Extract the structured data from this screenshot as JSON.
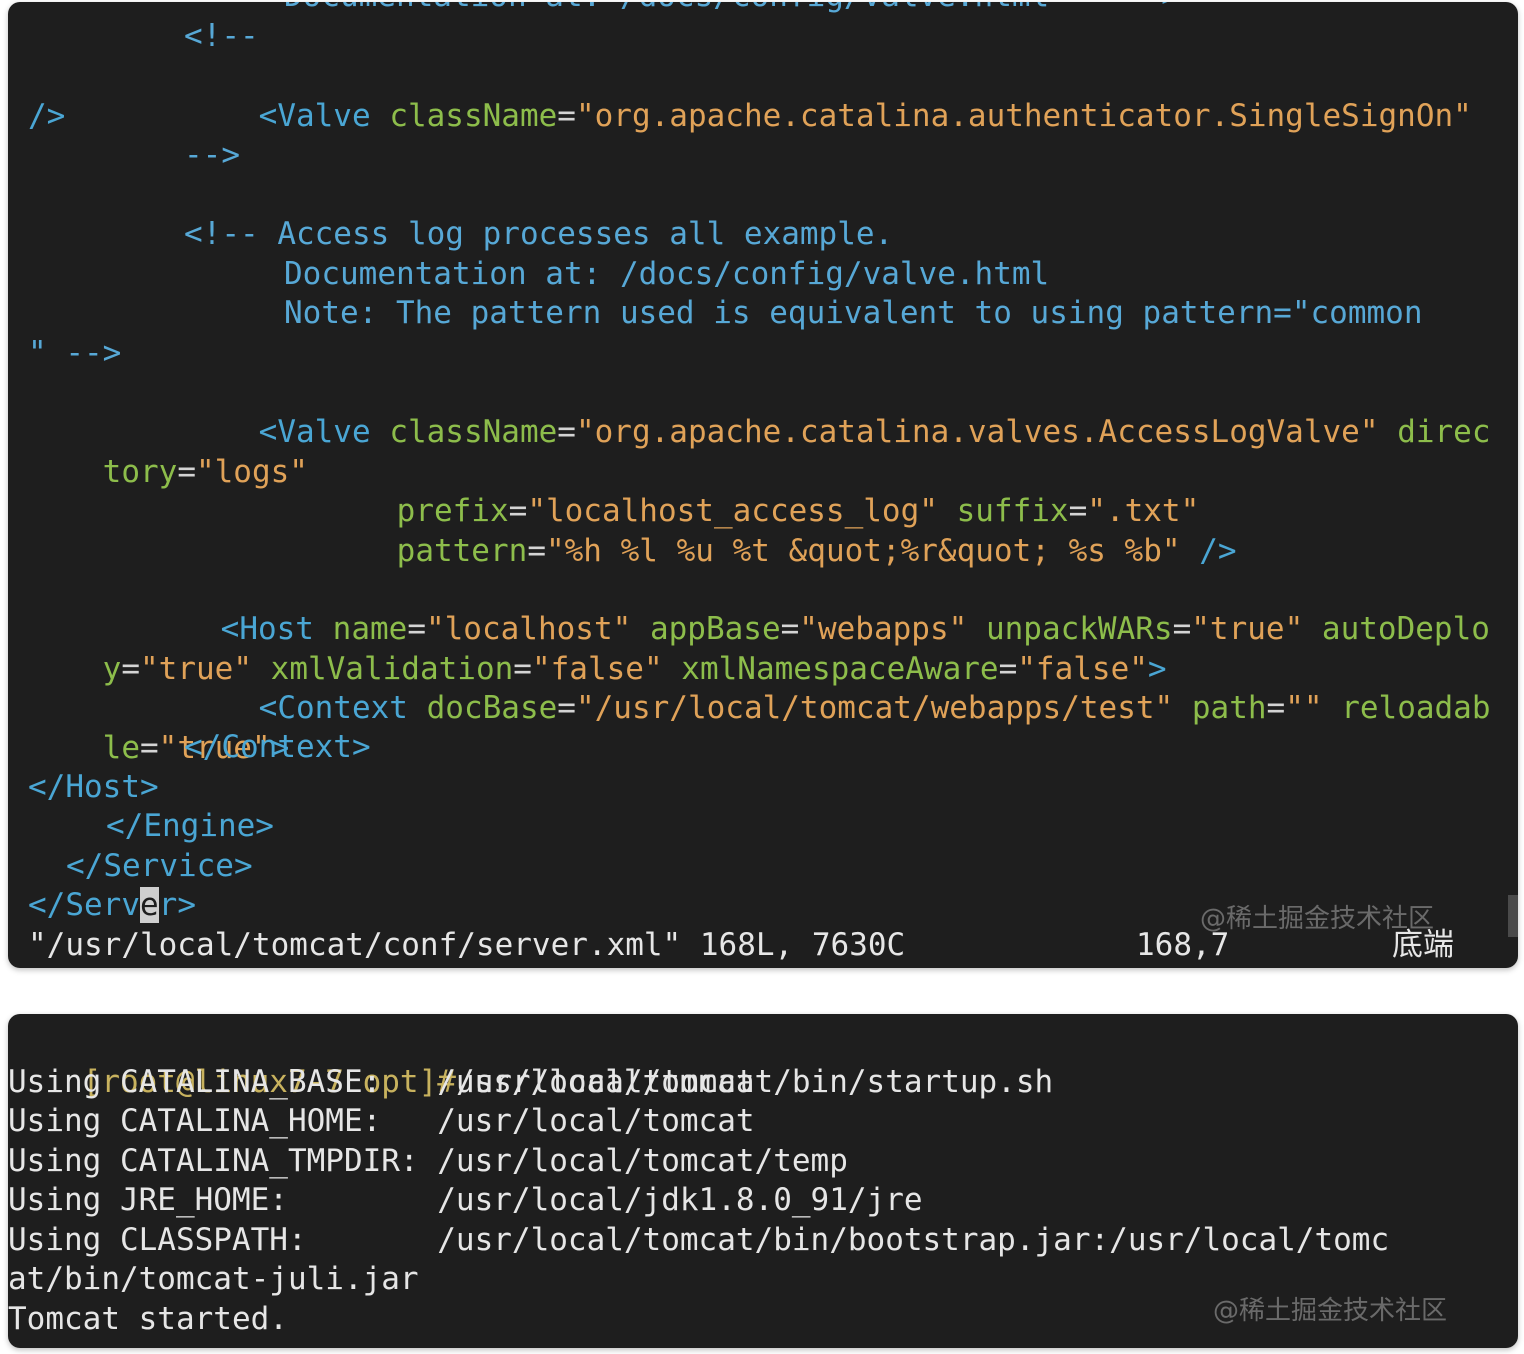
{
  "editor": {
    "lines": [
      "Documentation at: /docs/config/valve.html    -->",
      "<!--",
      "<Valve className=\"org.apache.catalina.authenticator.SingleSignOn\"",
      "/>",
      "-->",
      "<!-- Access log processes all example.",
      "Documentation at: /docs/config/valve.html",
      "Note: The pattern used is equivalent to using pattern=\"common",
      "\" -->",
      "<Valve className=\"org.apache.catalina.valves.AccessLogValve\" direc",
      "tory=\"logs\"",
      "prefix=\"localhost_access_log\" suffix=\".txt\"",
      "pattern=\"%h %l %u %t &quot;%r&quot; %s %b\" />",
      "<Host name=\"localhost\" appBase=\"webapps\" unpackWARs=\"true\" autoDeplo",
      "y=\"true\" xmlValidation=\"false\" xmlNamespaceAware=\"false\">",
      "<Context docBase=\"/usr/local/tomcat/webapps/test\" path=\"\" reloadab",
      "le=\"true\">",
      "</Context>",
      "</Host>",
      "</Engine>",
      "</Service>",
      "</Server>"
    ],
    "status_file": "\"/usr/local/tomcat/conf/server.xml\" 168L, 7630C",
    "status_pos": "168,7",
    "status_scroll": "底端",
    "watermark": "@稀土掘金技术社区"
  },
  "shell": {
    "prompt": "[root@linux7-7 opt]#",
    "command": "/usr/local/tomcat/bin/startup.sh",
    "output": [
      "Using CATALINA_BASE:   /usr/local/tomcat",
      "Using CATALINA_HOME:   /usr/local/tomcat",
      "Using CATALINA_TMPDIR: /usr/local/tomcat/temp",
      "Using JRE_HOME:        /usr/local/jdk1.8.0_91/jre",
      "Using CLASSPATH:       /usr/local/tomcat/bin/bootstrap.jar:/usr/local/tomc",
      "at/bin/tomcat-juli.jar",
      "Tomcat started."
    ],
    "watermark": "@稀土掘金技术社区"
  }
}
